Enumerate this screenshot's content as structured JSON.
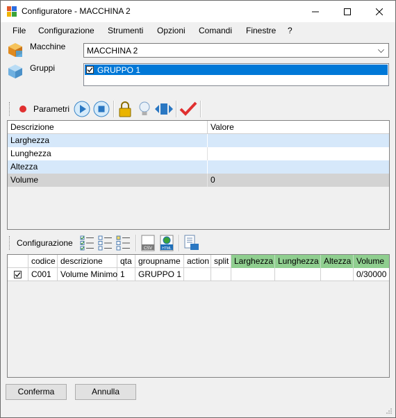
{
  "window": {
    "title": "Configuratore - MACCHINA 2"
  },
  "menu": [
    "File",
    "Configurazione",
    "Strumenti",
    "Opzioni",
    "Comandi",
    "Finestre",
    "?"
  ],
  "macchine": {
    "label": "Macchine",
    "value": "MACCHINA 2"
  },
  "gruppi": {
    "label": "Gruppi",
    "items": [
      {
        "label": "GRUPPO 1",
        "checked": true
      }
    ]
  },
  "parametri": {
    "toolbar_label": "Parametri",
    "headers": [
      "Descrizione",
      "Valore"
    ],
    "rows": [
      {
        "descrizione": "Larghezza",
        "valore": ""
      },
      {
        "descrizione": "Lunghezza",
        "valore": ""
      },
      {
        "descrizione": "Altezza",
        "valore": ""
      },
      {
        "descrizione": "Volume",
        "valore": "0"
      }
    ]
  },
  "configurazione": {
    "toolbar_label": "Configurazione",
    "headers": [
      "",
      "codice",
      "descrizione",
      "qta",
      "groupname",
      "action",
      "split",
      "Larghezza",
      "Lunghezza",
      "Altezza",
      "Volume"
    ],
    "rows": [
      {
        "checked": true,
        "codice": "C001",
        "descrizione": "Volume Minimo",
        "qta": "1",
        "groupname": "GRUPPO 1",
        "action": "",
        "split": "",
        "larghezza": "",
        "lunghezza": "",
        "altezza": "",
        "volume": "0/30000"
      }
    ]
  },
  "buttons": {
    "confirm": "Conferma",
    "cancel": "Annulla"
  },
  "colors": {
    "selection": "#0078d7",
    "row_alt": "#d6e8fa",
    "header_green": "#8fce8f",
    "row_gray": "#d3d3d3"
  }
}
